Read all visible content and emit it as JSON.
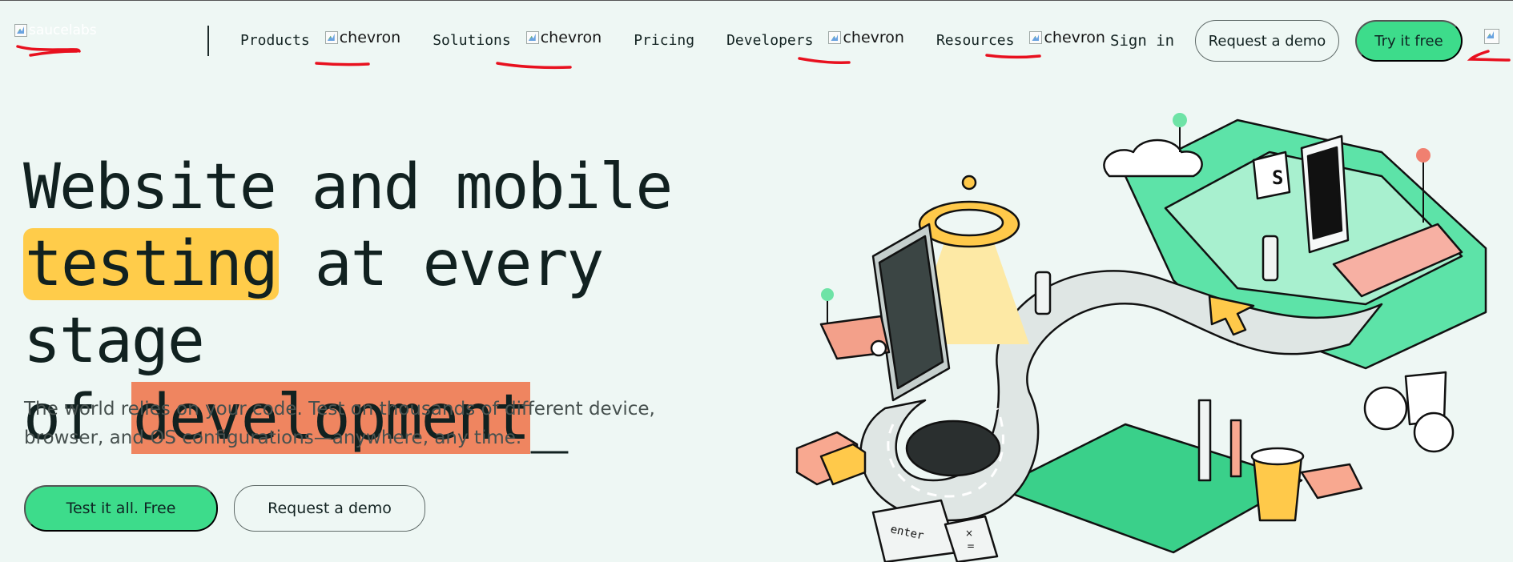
{
  "header": {
    "logo_alt": "saucelabs",
    "nav": [
      {
        "label": "Products",
        "chevron_alt": "chevron"
      },
      {
        "label": "Solutions",
        "chevron_alt": "chevron"
      },
      {
        "label": "Pricing"
      },
      {
        "label": "Developers",
        "chevron_alt": "chevron"
      },
      {
        "label": "Resources",
        "chevron_alt": "chevron"
      }
    ],
    "sign_in": "Sign in",
    "request_demo": "Request a demo",
    "try_free": "Try it free"
  },
  "hero": {
    "line1": "Website and mobile",
    "line2_highlight": "testing",
    "line2_rest": " at every stage",
    "line3_prefix": "of ",
    "line3_highlight": "development",
    "cursor": "_",
    "subtitle_line1": "The world relies on your code. Test on thousands of different device,",
    "subtitle_line2": "browser, and OS configurations—anywhere, any time.",
    "cta_primary": "Test it all. Free",
    "cta_secondary": "Request a demo"
  },
  "illustration": {
    "logo_glyph": "S",
    "key_enter": "enter",
    "key_times": "×",
    "key_equals": "="
  },
  "colors": {
    "background": "#eef7f4",
    "brand_green": "#3ddc8b",
    "highlight_yellow": "#ffcc4a",
    "highlight_orange": "#ef8560",
    "annotation_red": "#e8101e"
  },
  "icons": [
    "chevron-icon",
    "broken-image-icon"
  ]
}
